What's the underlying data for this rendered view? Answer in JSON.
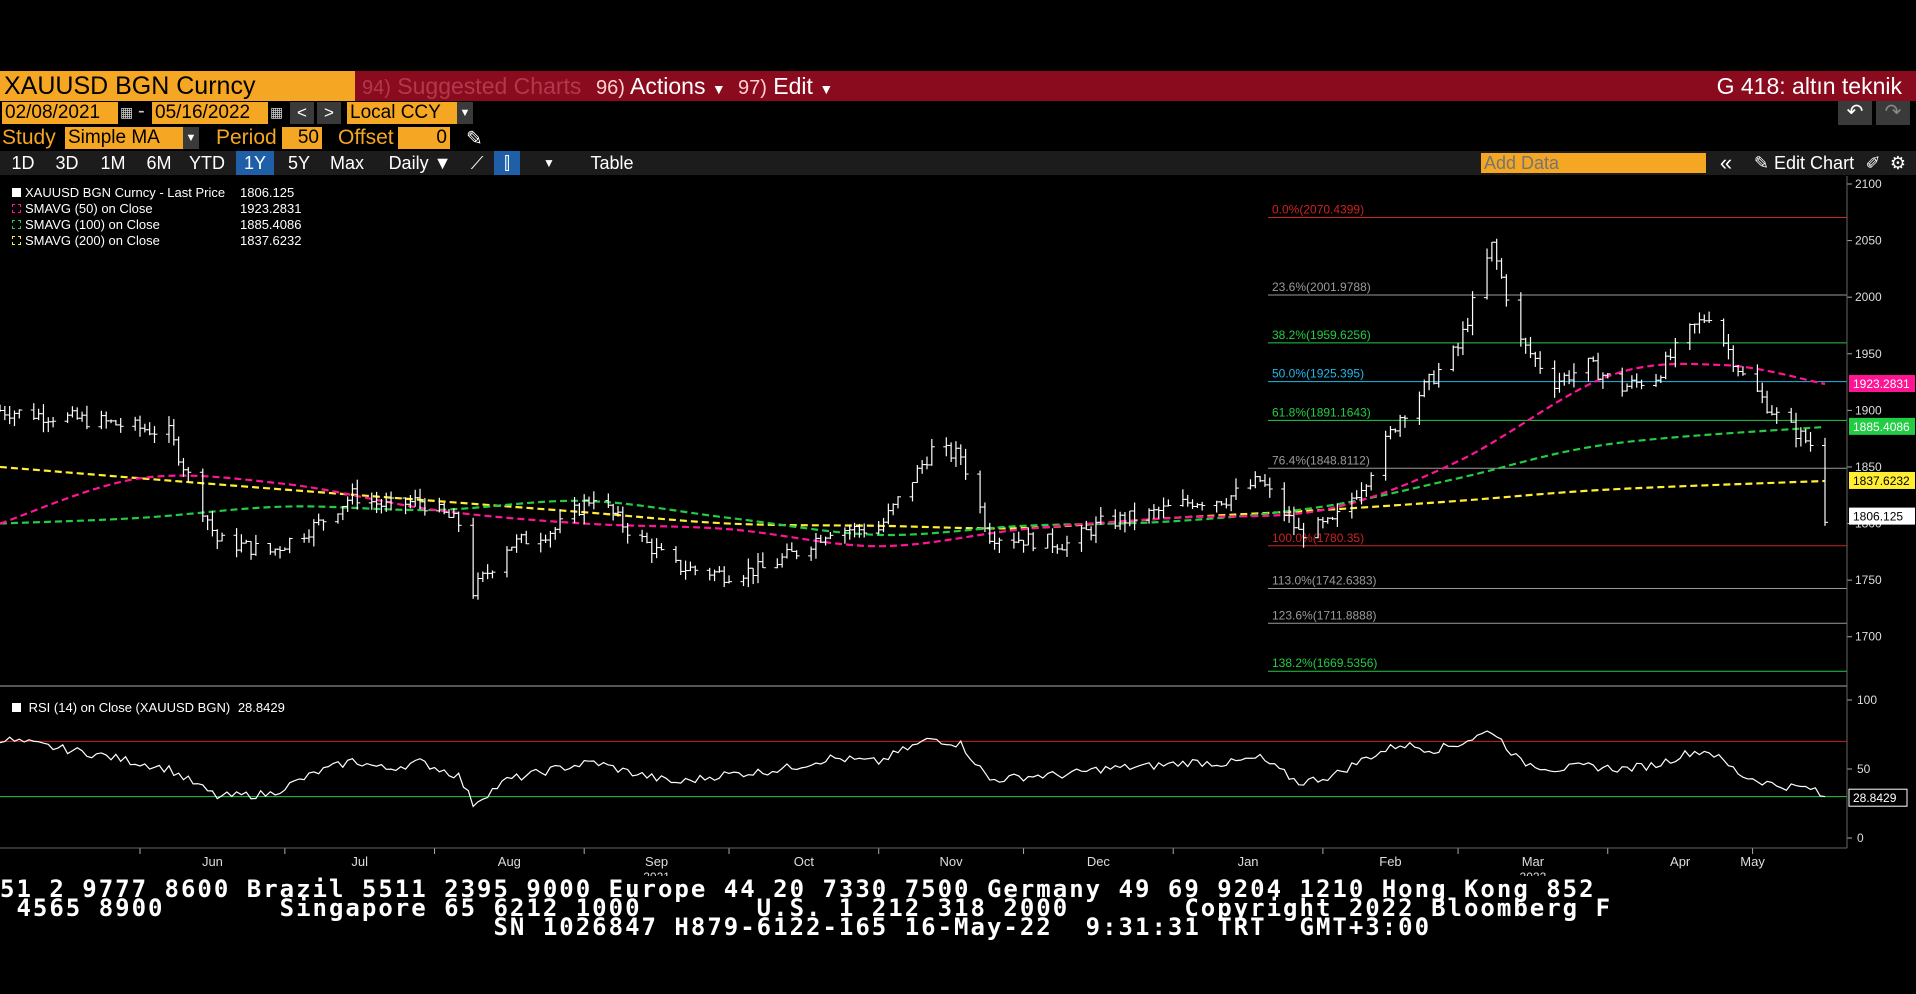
{
  "header": {
    "ticker": "XAUUSD BGN Curncy",
    "suggested": {
      "num": "94)",
      "label": "Suggested Charts"
    },
    "actions": {
      "num": "96)",
      "label": "Actions"
    },
    "edit": {
      "num": "97)",
      "label": "Edit"
    },
    "page_title": "G 418: altın teknik"
  },
  "options": {
    "start_date": "02/08/2021",
    "date_sep": "-",
    "end_date": "05/16/2022",
    "currency": "Local CCY",
    "study_label": "Study",
    "study_value": "Simple MA",
    "period_label": "Period",
    "period_value": "50",
    "offset_label": "Offset",
    "offset_value": "0"
  },
  "toolbar": {
    "ranges": [
      "1D",
      "3D",
      "1M",
      "6M",
      "YTD",
      "1Y",
      "5Y",
      "Max"
    ],
    "active_range": "1Y",
    "frequency": "Daily",
    "table_label": "Table",
    "add_data_placeholder": "Add Data",
    "edit_chart_label": "Edit Chart"
  },
  "legend": [
    {
      "name": "XAUUSD BGN Curncy - Last Price",
      "value": "1806.125",
      "color": "#ffffff"
    },
    {
      "name": "SMAVG (50)  on Close",
      "value": "1923.2831",
      "color": "#ff1493"
    },
    {
      "name": "SMAVG (100)  on Close",
      "value": "1885.4086",
      "color": "#22cc44"
    },
    {
      "name": "SMAVG (200)  on Close",
      "value": "1837.6232",
      "color": "#ffee33"
    }
  ],
  "rsi_legend": {
    "name": "RSI (14)  on Close (XAUUSD BGN)",
    "value": "28.8429"
  },
  "colors": {
    "accent": "#f5a623",
    "header_bg": "#8a0a1e",
    "sma50": "#ff1493",
    "sma100": "#22cc44",
    "sma200": "#ffee33"
  },
  "chart_data": {
    "type": "bar",
    "x_range": [
      "2021-05-03",
      "2022-05-16"
    ],
    "ylim": [
      1660,
      2100
    ],
    "y_ticks": [
      1700,
      1750,
      1800,
      1850,
      1900,
      1950,
      2000,
      2050,
      2100
    ],
    "x_ticks": [
      "Jun",
      "Jul",
      "Aug",
      "Sep",
      "Oct",
      "Nov",
      "Dec",
      "Jan",
      "Feb",
      "Mar",
      "Apr",
      "May"
    ],
    "year_labels": [
      {
        "label": "2021",
        "at": "Sep"
      },
      {
        "label": "2022",
        "at": "Mar"
      }
    ],
    "price": {
      "name": "XAUUSD BGN Curncy - Last Price",
      "points": [
        [
          "2021-05-03",
          1900
        ],
        [
          "2021-05-24",
          1890
        ],
        [
          "2021-06-07",
          1880
        ],
        [
          "2021-06-17",
          1785
        ],
        [
          "2021-06-28",
          1775
        ],
        [
          "2021-07-08",
          1800
        ],
        [
          "2021-07-15",
          1825
        ],
        [
          "2021-07-22",
          1815
        ],
        [
          "2021-07-29",
          1820
        ],
        [
          "2021-08-06",
          1800
        ],
        [
          "2021-08-09",
          1740
        ],
        [
          "2021-08-16",
          1780
        ],
        [
          "2021-08-26",
          1795
        ],
        [
          "2021-09-03",
          1825
        ],
        [
          "2021-09-10",
          1795
        ],
        [
          "2021-09-20",
          1762
        ],
        [
          "2021-09-30",
          1755
        ],
        [
          "2021-10-08",
          1760
        ],
        [
          "2021-10-15",
          1775
        ],
        [
          "2021-10-22",
          1795
        ],
        [
          "2021-11-01",
          1795
        ],
        [
          "2021-11-05",
          1820
        ],
        [
          "2021-11-12",
          1865
        ],
        [
          "2021-11-18",
          1860
        ],
        [
          "2021-11-24",
          1790
        ],
        [
          "2021-12-03",
          1785
        ],
        [
          "2021-12-10",
          1782
        ],
        [
          "2021-12-17",
          1800
        ],
        [
          "2021-12-27",
          1808
        ],
        [
          "2022-01-05",
          1820
        ],
        [
          "2022-01-12",
          1822
        ],
        [
          "2022-01-19",
          1838
        ],
        [
          "2022-01-27",
          1792
        ],
        [
          "2022-02-03",
          1800
        ],
        [
          "2022-02-10",
          1840
        ],
        [
          "2022-02-17",
          1895
        ],
        [
          "2022-02-24",
          1930
        ],
        [
          "2022-03-01",
          1955
        ],
        [
          "2022-03-08",
          2045
        ],
        [
          "2022-03-14",
          1960
        ],
        [
          "2022-03-21",
          1925
        ],
        [
          "2022-03-28",
          1940
        ],
        [
          "2022-04-04",
          1920
        ],
        [
          "2022-04-11",
          1930
        ],
        [
          "2022-04-18",
          1970
        ],
        [
          "2022-04-22",
          1985
        ],
        [
          "2022-04-29",
          1930
        ],
        [
          "2022-05-06",
          1895
        ],
        [
          "2022-05-13",
          1870
        ],
        [
          "2022-05-16",
          1806.125
        ]
      ]
    },
    "sma50": {
      "name": "SMAVG (50)  on Close",
      "last_value": "1923.2831",
      "points": [
        [
          "2021-05-03",
          1800
        ],
        [
          "2021-06-01",
          1840
        ],
        [
          "2021-07-01",
          1835
        ],
        [
          "2021-08-01",
          1812
        ],
        [
          "2021-09-01",
          1800
        ],
        [
          "2021-10-01",
          1795
        ],
        [
          "2021-11-01",
          1780
        ],
        [
          "2021-12-01",
          1795
        ],
        [
          "2022-01-01",
          1805
        ],
        [
          "2022-02-01",
          1812
        ],
        [
          "2022-03-01",
          1855
        ],
        [
          "2022-04-01",
          1930
        ],
        [
          "2022-04-25",
          1940
        ],
        [
          "2022-05-16",
          1923.2831
        ]
      ]
    },
    "sma100": {
      "name": "SMAVG (100)  on Close",
      "last_value": "1885.4086",
      "points": [
        [
          "2021-05-03",
          1800
        ],
        [
          "2021-06-01",
          1805
        ],
        [
          "2021-07-01",
          1815
        ],
        [
          "2021-08-01",
          1812
        ],
        [
          "2021-09-01",
          1820
        ],
        [
          "2021-10-01",
          1805
        ],
        [
          "2021-11-01",
          1790
        ],
        [
          "2021-12-01",
          1798
        ],
        [
          "2022-01-01",
          1802
        ],
        [
          "2022-02-01",
          1815
        ],
        [
          "2022-03-01",
          1840
        ],
        [
          "2022-04-01",
          1870
        ],
        [
          "2022-05-16",
          1885.4086
        ]
      ]
    },
    "sma200": {
      "name": "SMAVG (200)  on Close",
      "last_value": "1837.6232",
      "points": [
        [
          "2021-05-03",
          1850
        ],
        [
          "2021-06-01",
          1840
        ],
        [
          "2021-07-01",
          1830
        ],
        [
          "2021-08-01",
          1820
        ],
        [
          "2021-09-01",
          1810
        ],
        [
          "2021-10-01",
          1800
        ],
        [
          "2021-11-01",
          1798
        ],
        [
          "2021-12-01",
          1796
        ],
        [
          "2022-01-01",
          1805
        ],
        [
          "2022-02-01",
          1812
        ],
        [
          "2022-03-01",
          1820
        ],
        [
          "2022-04-01",
          1830
        ],
        [
          "2022-05-16",
          1837.6232
        ]
      ]
    },
    "fibonacci": [
      {
        "label": "0.0%(2070.4399)",
        "value": 2070.4399,
        "color": "#cc2222"
      },
      {
        "label": "23.6%(2001.9788)",
        "value": 2001.9788,
        "color": "#9a9a9a"
      },
      {
        "label": "38.2%(1959.6256)",
        "value": 1959.6256,
        "color": "#22cc44"
      },
      {
        "label": "50.0%(1925.395)",
        "value": 1925.395,
        "color": "#22b8e8"
      },
      {
        "label": "61.8%(1891.1643)",
        "value": 1891.1643,
        "color": "#22cc44"
      },
      {
        "label": "76.4%(1848.8112)",
        "value": 1848.8112,
        "color": "#9a9a9a"
      },
      {
        "label": "100.0%(1780.35)",
        "value": 1780.35,
        "color": "#cc2222"
      },
      {
        "label": "113.0%(1742.6383)",
        "value": 1742.6383,
        "color": "#9a9a9a"
      },
      {
        "label": "123.6%(1711.8888)",
        "value": 1711.8888,
        "color": "#9a9a9a"
      },
      {
        "label": "138.2%(1669.5356)",
        "value": 1669.5356,
        "color": "#22cc44"
      }
    ],
    "price_labels": [
      {
        "value": "1923.2831",
        "color": "#ff1493",
        "text_color": "#ffffff"
      },
      {
        "value": "1885.4086",
        "color": "#22cc44",
        "text_color": "#ffffff"
      },
      {
        "value": "1837.6232",
        "color": "#ffee33",
        "text_color": "#000000"
      },
      {
        "value": "1806.125",
        "color": "#ffffff",
        "text_color": "#000000"
      }
    ],
    "rsi": {
      "name": "RSI (14)  on Close (XAUUSD BGN)",
      "ylim": [
        0,
        100
      ],
      "y_ticks": [
        0,
        50,
        100
      ],
      "overbought": 70,
      "oversold": 30,
      "last_value": "28.8429",
      "points": [
        [
          "2021-05-03",
          72
        ],
        [
          "2021-05-24",
          60
        ],
        [
          "2021-06-07",
          50
        ],
        [
          "2021-06-17",
          30
        ],
        [
          "2021-06-28",
          32
        ],
        [
          "2021-07-08",
          48
        ],
        [
          "2021-07-15",
          56
        ],
        [
          "2021-07-22",
          50
        ],
        [
          "2021-07-29",
          55
        ],
        [
          "2021-08-06",
          45
        ],
        [
          "2021-08-09",
          25
        ],
        [
          "2021-08-16",
          42
        ],
        [
          "2021-08-26",
          50
        ],
        [
          "2021-09-03",
          55
        ],
        [
          "2021-09-10",
          48
        ],
        [
          "2021-09-20",
          40
        ],
        [
          "2021-09-30",
          46
        ],
        [
          "2021-10-08",
          48
        ],
        [
          "2021-10-15",
          52
        ],
        [
          "2021-10-22",
          58
        ],
        [
          "2021-11-01",
          55
        ],
        [
          "2021-11-05",
          62
        ],
        [
          "2021-11-12",
          72
        ],
        [
          "2021-11-18",
          68
        ],
        [
          "2021-11-24",
          42
        ],
        [
          "2021-12-03",
          45
        ],
        [
          "2021-12-10",
          46
        ],
        [
          "2021-12-17",
          50
        ],
        [
          "2021-12-27",
          52
        ],
        [
          "2022-01-05",
          55
        ],
        [
          "2022-01-12",
          54
        ],
        [
          "2022-01-19",
          58
        ],
        [
          "2022-01-27",
          40
        ],
        [
          "2022-02-03",
          45
        ],
        [
          "2022-02-10",
          58
        ],
        [
          "2022-02-17",
          68
        ],
        [
          "2022-02-24",
          64
        ],
        [
          "2022-03-01",
          68
        ],
        [
          "2022-03-08",
          78
        ],
        [
          "2022-03-14",
          55
        ],
        [
          "2022-03-21",
          50
        ],
        [
          "2022-03-28",
          52
        ],
        [
          "2022-04-04",
          50
        ],
        [
          "2022-04-11",
          53
        ],
        [
          "2022-04-18",
          62
        ],
        [
          "2022-04-22",
          63
        ],
        [
          "2022-04-29",
          45
        ],
        [
          "2022-05-06",
          38
        ],
        [
          "2022-05-13",
          36
        ],
        [
          "2022-05-16",
          28.8429
        ]
      ]
    }
  },
  "footer": {
    "line1": "51 2 9777 8600 Brazil 5511 2395 9000 Europe 44 20 7330 7500 Germany 49 69 9204 1210 Hong Kong 852",
    "line2": " 4565 8900       Singapore 65 6212 1000       U.S. 1 212 318 2000       Copyright 2022 Bloomberg F",
    "line3": "                              SN 1026847 H879-6122-165 16-May-22  9:31:31 TRT  GMT+3:00"
  }
}
